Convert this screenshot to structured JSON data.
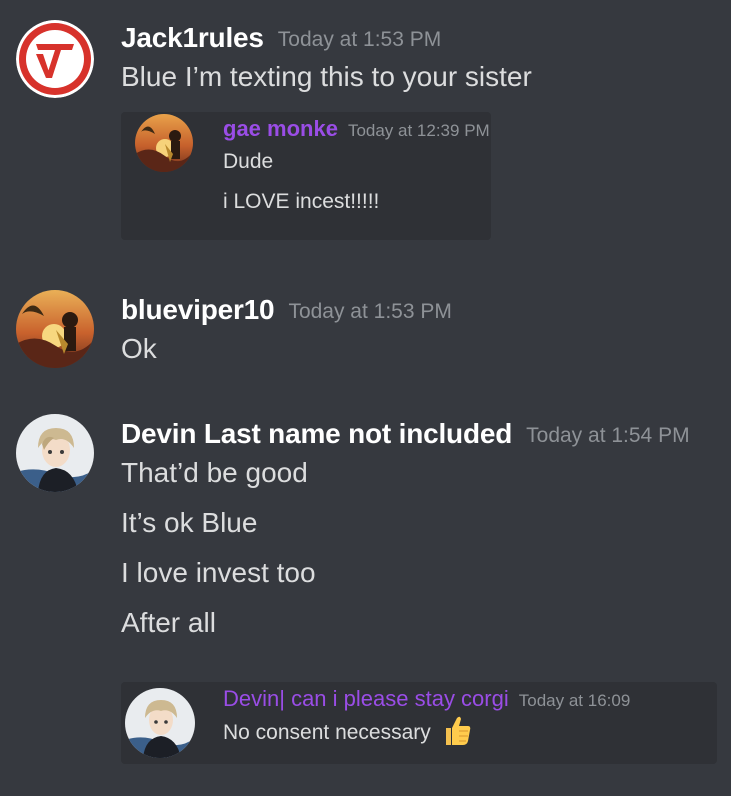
{
  "messages": [
    {
      "username": "Jack1rules",
      "timestamp": "Today at 1:53 PM",
      "lines": [
        "Blue I’m texting this to your sister"
      ],
      "quote": {
        "username": "gae monke",
        "timestamp": "Today at 12:39 PM",
        "lines": [
          "Dude",
          "i LOVE incest!!!!!"
        ]
      }
    },
    {
      "username": "blueviper10",
      "timestamp": "Today at 1:53 PM",
      "lines": [
        "Ok"
      ]
    },
    {
      "username": "Devin Last name not included",
      "timestamp": "Today at 1:54 PM",
      "lines": [
        "That’d be good",
        "It’s ok Blue",
        "I love invest too",
        "After all"
      ],
      "quote": {
        "username": "Devin| can i please stay corgi",
        "timestamp": "Today at 16:09",
        "lines": [
          "No consent necessary"
        ],
        "emoji": "thumbs-up-icon"
      }
    }
  ],
  "colors": {
    "background": "#36393f",
    "quote_background": "#2f3136",
    "username": "#ffffff",
    "timestamp": "#8e9297",
    "text": "#dcddde",
    "quote_username": "#9a4de6",
    "jack_logo_red": "#d7322b"
  }
}
